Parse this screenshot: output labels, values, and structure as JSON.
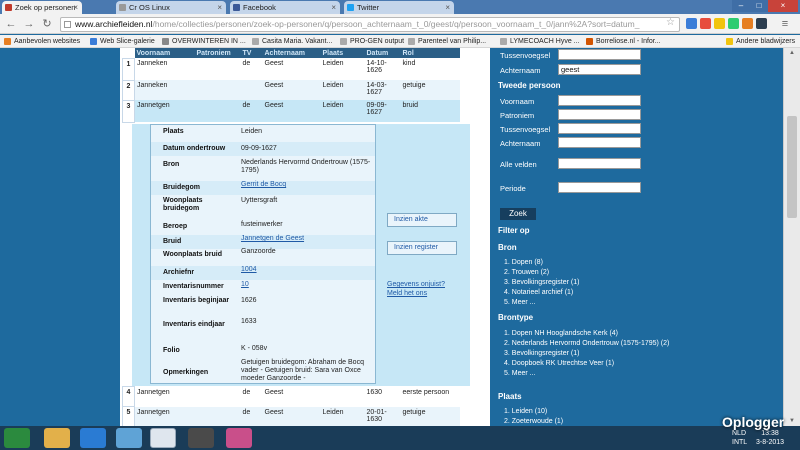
{
  "browser": {
    "tabs": [
      {
        "label": "Zoek op personen",
        "favicon_color": "#c0392b"
      },
      {
        "label": "Cr OS Linux",
        "favicon_color": "#999999"
      },
      {
        "label": "Facebook",
        "favicon_color": "#3b5998"
      },
      {
        "label": "Twitter",
        "favicon_color": "#1da1f2"
      }
    ],
    "url_host": "www.archiefleiden.nl",
    "url_path": "/home/collecties/personen/zoek-op-personen/q/persoon_achternaam_t_0/geest/q/persoon_voornaam_t_0/jann%2A?sort=datum_",
    "bookmarks": [
      "Aanbevolen websites",
      "Web Slice-galerie",
      "OVERWINTEREN IN ...",
      "Casita Maria. Vakant...",
      "PRO-GEN output",
      "Parenteel van Philip...",
      "LYMECOACH Hyve ...",
      "Borreliose.nl - Infor..."
    ],
    "other_bookmarks": "Andere bladwijzers"
  },
  "table": {
    "headers": [
      "Voornaam",
      "Patroniem",
      "TV",
      "Achternaam",
      "Plaats",
      "Datum",
      "Rol"
    ],
    "rows": [
      {
        "num": "1",
        "voornaam": "Janneken",
        "patroniem": "",
        "tv": "de",
        "achternaam": "Geest",
        "plaats": "Leiden",
        "datum": "14-10-1626",
        "rol": "kind"
      },
      {
        "num": "2",
        "voornaam": "Janneken",
        "patroniem": "",
        "tv": "",
        "achternaam": "Geest",
        "plaats": "Leiden",
        "datum": "14-03-1627",
        "rol": "getuige"
      },
      {
        "num": "3",
        "voornaam": "Jannetgen",
        "patroniem": "",
        "tv": "de",
        "achternaam": "Geest",
        "plaats": "Leiden",
        "datum": "09-09-1627",
        "rol": "bruid"
      },
      {
        "num": "4",
        "voornaam": "Jannetgen",
        "patroniem": "",
        "tv": "de",
        "achternaam": "Geest",
        "plaats": "",
        "datum": "1630",
        "rol": "eerste persoon"
      },
      {
        "num": "5",
        "voornaam": "Jannetgen",
        "patroniem": "",
        "tv": "de",
        "achternaam": "Geest",
        "plaats": "Leiden",
        "datum": "20-01-1630",
        "rol": "getuige"
      }
    ]
  },
  "detail": {
    "plaats_label": "Plaats",
    "plaats": "Leiden",
    "datum_label": "Datum ondertrouw",
    "datum": "09-09-1627",
    "bron_label": "Bron",
    "bron": "Nederlands Hervormd Ondertrouw (1575-1795)",
    "bruidegom_label": "Bruidegom",
    "bruidegom": "Gerrit de Bocq",
    "woonplaats_bruidegom_label": "Woonplaats bruidegom",
    "woonplaats_bruidegom": "Uyttersgraft",
    "beroep_label": "Beroep",
    "beroep": "fusteinwerker",
    "bruid_label": "Bruid",
    "bruid": "Jannetgen de Geest",
    "woonplaats_bruid_label": "Woonplaats bruid",
    "woonplaats_bruid": "Ganzoorde",
    "archiefnr_label": "Archiefnr",
    "archiefnr": "1004",
    "inventarisnummer_label": "Inventarisnummer",
    "inventarisnummer": "10",
    "inv_begin_label": "Inventaris beginjaar",
    "inv_begin": "1626",
    "inv_eind_label": "Inventaris eindjaar",
    "inv_eind": "1633",
    "folio_label": "Folio",
    "folio": "K - 058v",
    "opmerkingen_label": "Opmerkingen",
    "opmerkingen": "Getuigen bruidegom: Abraham de Bocq vader - Getuigen bruid: Sara van Oxce moeder Ganzoorde -",
    "btn_akte": "Inzien akte",
    "btn_register": "Inzien register",
    "link_onjuist": "Gegevens onjuist?",
    "link_meld": "Meld het ons"
  },
  "search": {
    "tussenvoegsel_label": "Tussenvoegsel",
    "achternaam_label": "Achternaam",
    "achternaam_value": "geest",
    "tweede_persoon": "Tweede persoon",
    "voornaam_label": "Voornaam",
    "patroniem_label": "Patroniem",
    "tussenvoegsel2_label": "Tussenvoegsel",
    "achternaam2_label": "Achternaam",
    "alle_velden_label": "Alle velden",
    "periode_label": "Periode",
    "zoek_button": "Zoek"
  },
  "filters": {
    "title": "Filter op",
    "bron_title": "Bron",
    "bron_items": [
      "1. Dopen (8)",
      "2. Trouwen (2)",
      "3. Bevolkingsregister (1)",
      "4. Notarieel archief (1)",
      "5. Meer ..."
    ],
    "brontype_title": "Brontype",
    "brontype_items": [
      "1. Dopen NH Hooglandsche Kerk (4)",
      "2. Nederlands Hervormd Ondertrouw (1575-1795) (2)",
      "3. Bevolkingsregister (1)",
      "4. Doopboek RK Utrechtse Veer (1)",
      "5. Meer ..."
    ],
    "plaats_title": "Plaats",
    "plaats_items": [
      "1. Leiden (10)",
      "2. Zoeterwoude (1)"
    ]
  },
  "taskbar": {
    "lang": "NLD",
    "lang2": "INTL",
    "time": "13:38",
    "date": "3-8-2013",
    "watermark": "Oplogger"
  }
}
